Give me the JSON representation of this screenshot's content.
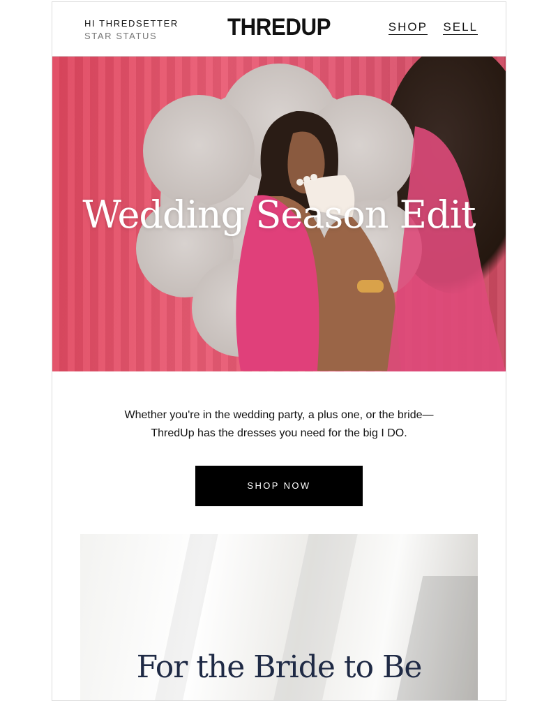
{
  "header": {
    "greeting": "HI THREDSETTER",
    "status": "STAR STATUS",
    "logo": "THREDUP",
    "nav": [
      {
        "label": "SHOP"
      },
      {
        "label": "SELL"
      }
    ]
  },
  "hero": {
    "title": "Wedding Season Edit"
  },
  "body": {
    "line1": "Whether you're in the wedding party, a plus one, or the bride—",
    "line2": "ThredUp has the dresses you need for the big I DO.",
    "cta": "SHOP NOW"
  },
  "bride": {
    "title": "For the Bride to Be"
  },
  "colors": {
    "hero_pink": "#e35672",
    "button_bg": "#000000",
    "bride_title": "#1f2a45"
  }
}
